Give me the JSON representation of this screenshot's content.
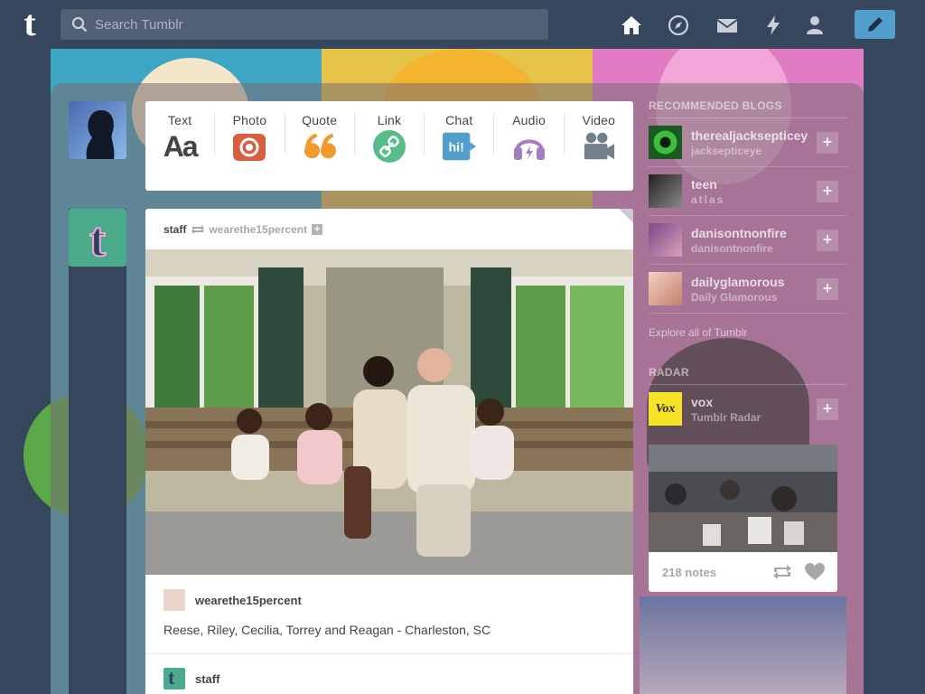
{
  "search": {
    "placeholder": "Search Tumblr"
  },
  "nav": {
    "icons": [
      "home-icon",
      "explore-compass-icon",
      "inbox-envelope-icon",
      "activity-lightning-icon",
      "account-person-icon",
      "compose-pencil-icon"
    ]
  },
  "post_types": [
    {
      "label": "Text",
      "icon": "text-aa-icon",
      "color": "#444444"
    },
    {
      "label": "Photo",
      "icon": "camera-icon",
      "color": "#d95e40"
    },
    {
      "label": "Quote",
      "icon": "quote-icon",
      "color": "#f2992e"
    },
    {
      "label": "Link",
      "icon": "link-icon",
      "color": "#56bc8a"
    },
    {
      "label": "Chat",
      "icon": "chat-bubble-icon",
      "color": "#529ecc"
    },
    {
      "label": "Audio",
      "icon": "headphones-icon",
      "color": "#a77dc2"
    },
    {
      "label": "Video",
      "icon": "video-camera-icon",
      "color": "#748089"
    }
  ],
  "post": {
    "author": "staff",
    "reblogged_from": "wearethe15percent",
    "source_blog": "wearethe15percent",
    "caption": "Reese, Riley, Cecilia, Torrey and Reagan - Charleston, SC",
    "commenter": "staff"
  },
  "sidebar": {
    "recommended_title": "RECOMMENDED BLOGS",
    "blogs": [
      {
        "name": "therealjacksepticeye",
        "sub": "jacksepticeye"
      },
      {
        "name": "teen",
        "sub": "atlas"
      },
      {
        "name": "danisontnonfire",
        "sub": "danisontnonfire"
      },
      {
        "name": "dailyglamorous",
        "sub": "Daily Glamorous"
      }
    ],
    "explore_link": "Explore all of Tumblr",
    "radar_title": "RADAR",
    "radar": {
      "name": "vox",
      "sub": "Tumblr Radar",
      "avatar_text": "Vox",
      "notes": "218 notes"
    }
  },
  "colors": {
    "brand": "#36465d",
    "compose": "#529ecc",
    "radar_yellow": "#f6e326"
  }
}
